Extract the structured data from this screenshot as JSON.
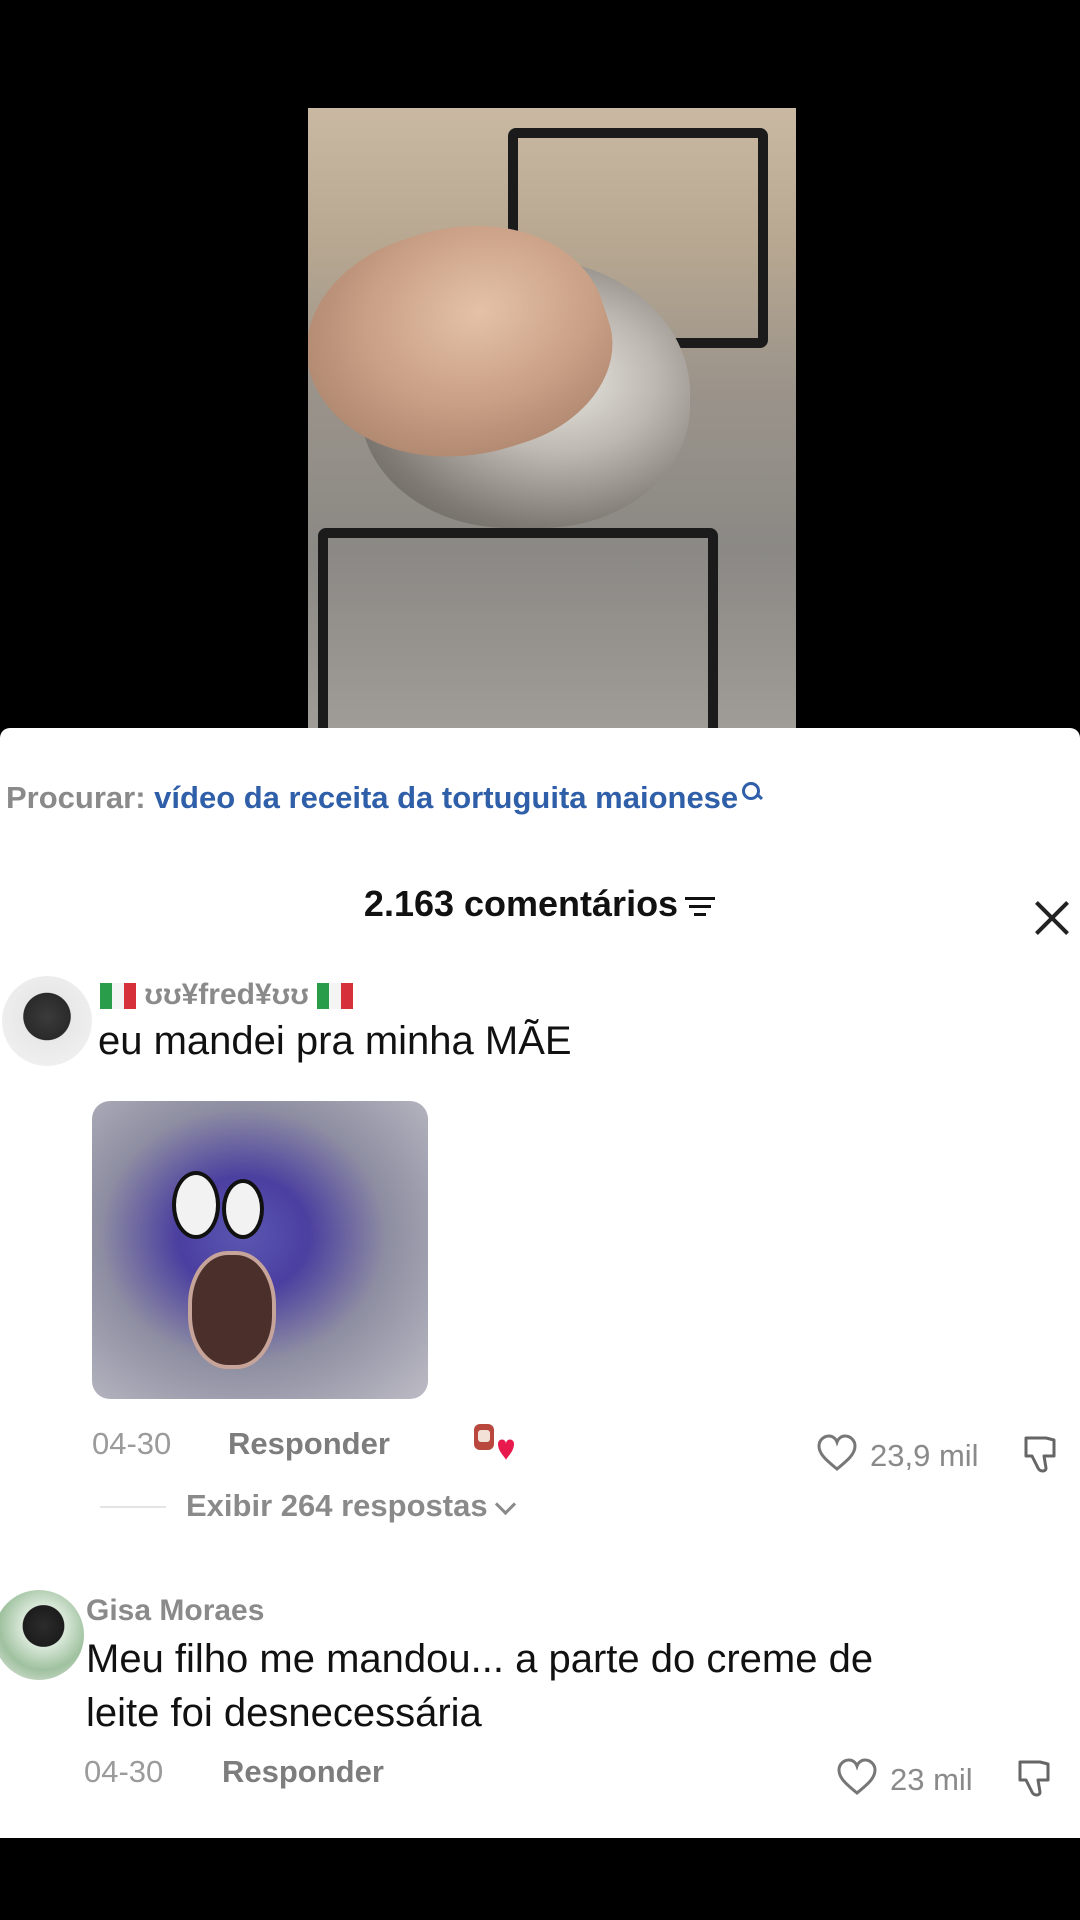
{
  "search": {
    "label": "Procurar:",
    "query": "vídeo da receita da tortuguita maionese"
  },
  "comments_header": {
    "count_text": "2.163 comentários"
  },
  "comments": [
    {
      "username": "ʊʊ¥fred¥ʊʊ",
      "text": "eu mandei pra minha MÃE",
      "date": "04-30",
      "reply_label": "Responder",
      "likes": "23,9 mil",
      "view_replies": "Exibir 264 respostas"
    },
    {
      "username": "Gisa Moraes",
      "text_line1": "Meu filho me mandou... a parte do creme de",
      "text_line2": "leite foi desnecessária",
      "date": "04-30",
      "reply_label": "Responder",
      "likes": "23 mil"
    }
  ],
  "colors": {
    "search_query": "#2f5fa8",
    "muted_text": "#8a8a8a",
    "sheet_bg": "#ffffff",
    "heart_red": "#e8194c"
  },
  "icons": [
    "search-icon",
    "filter-icon",
    "close-icon",
    "heart-icon",
    "dislike-icon",
    "chevron-down-icon",
    "italy-flag-icon"
  ]
}
